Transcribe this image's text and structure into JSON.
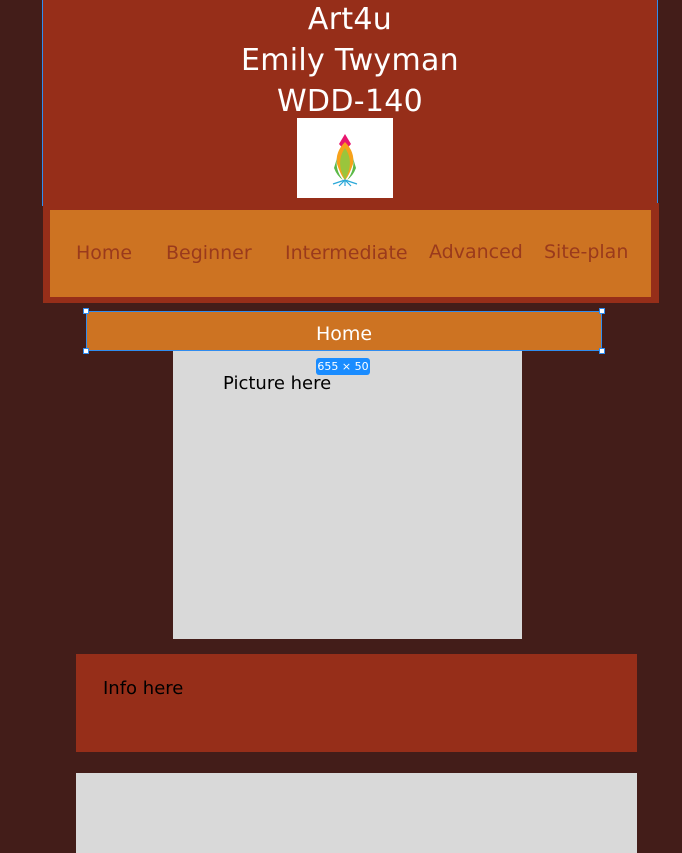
{
  "header": {
    "site_name": "Art4u",
    "author": "Emily Twyman",
    "course": "WDD-140",
    "logo_icon": "lotus-flower-icon"
  },
  "nav": {
    "items": [
      {
        "label": "Home"
      },
      {
        "label": "Beginner"
      },
      {
        "label": "Intermediate"
      },
      {
        "label": "Advanced"
      },
      {
        "label": "Site-plan"
      }
    ]
  },
  "selected_frame": {
    "label": "Home",
    "size_badge": "655 × 50"
  },
  "picture": {
    "label": "Picture here"
  },
  "info": {
    "label": "Info here"
  },
  "colors": {
    "background": "#431d19",
    "header": "#962e19",
    "nav": "#cd7322",
    "nav_text": "#9a3a1c",
    "placeholder": "#d9d9d9",
    "selection": "#2f8cf0"
  }
}
